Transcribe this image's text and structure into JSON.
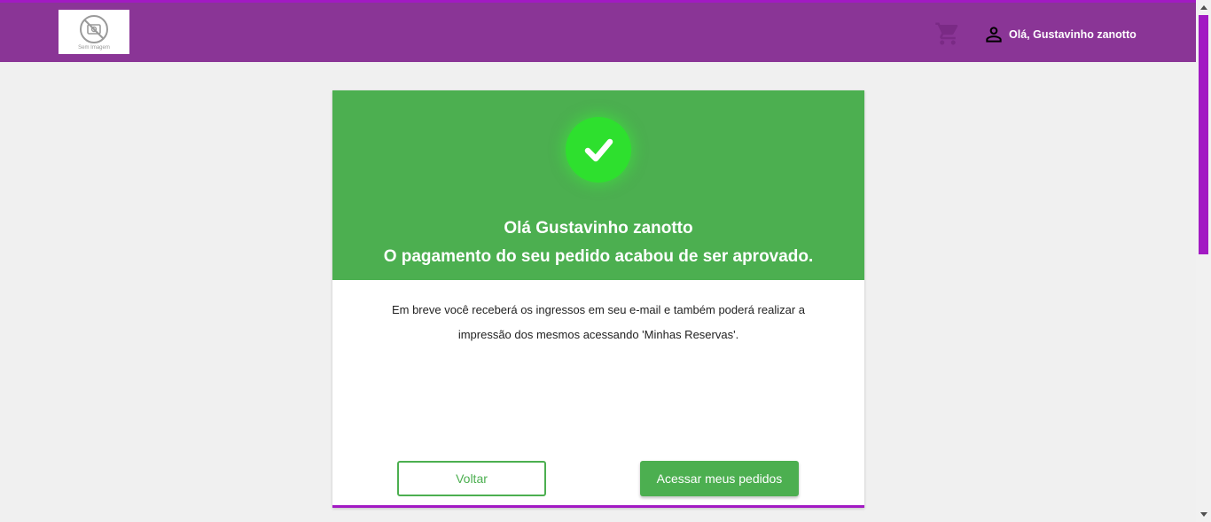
{
  "header": {
    "logo_caption": "Sem Imagem",
    "user_greeting": "Olá, Gustavinho zanotto",
    "icons": {
      "logo": "no-image-icon",
      "cart": "shopping-cart-icon",
      "user": "person-icon"
    }
  },
  "card": {
    "greeting_line1": "Olá Gustavinho zanotto",
    "greeting_line2": "O pagamento do seu pedido acabou de ser aprovado.",
    "message_line1": "Em breve você receberá os ingressos em seu e-mail e também poderá realizar a",
    "message_line2": "impressão dos mesmos acessando 'Minhas Reservas'.",
    "back_label": "Voltar",
    "orders_label": "Acessar meus pedidos"
  },
  "colors": {
    "header_bg": "#8a3596",
    "accent": "#a21ac3",
    "success": "#4caf50",
    "check": "#2ee02e"
  }
}
